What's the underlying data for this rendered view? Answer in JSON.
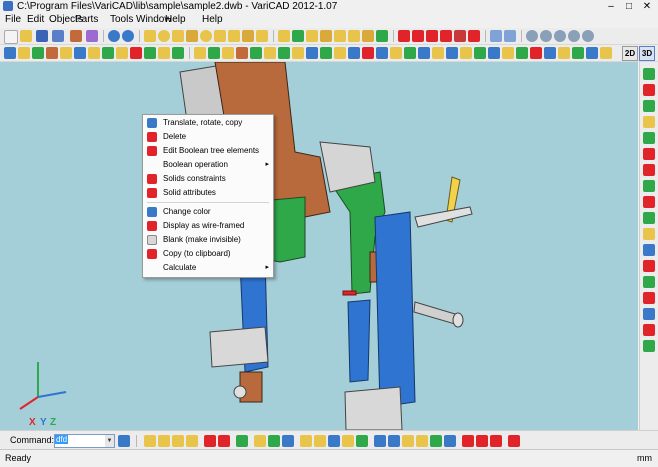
{
  "window": {
    "title": "C:\\Program Files\\VariCAD\\lib\\sample\\sample2.dwb - VariCAD 2012-1.07",
    "minimize": "–",
    "maximize": "□",
    "close": "✕"
  },
  "menu": [
    "File",
    "Edit",
    "Objects",
    "Parts",
    "Tools",
    "Window",
    "Help"
  ],
  "toolbar": {
    "view2d": "2D",
    "view3d": "3D"
  },
  "context_menu": {
    "items": [
      {
        "label": "Translate, rotate, copy",
        "icon": "translate-icon",
        "submenu": false
      },
      {
        "label": "Delete",
        "icon": "delete-icon",
        "submenu": false
      },
      {
        "label": "Edit Boolean tree elements",
        "icon": "boolean-tree-icon",
        "submenu": false
      },
      {
        "label": "Boolean operation",
        "icon": "",
        "submenu": true
      },
      {
        "label": "Solids constraints",
        "icon": "constraints-icon",
        "submenu": false
      },
      {
        "label": "Solid attributes",
        "icon": "attributes-icon",
        "submenu": false
      },
      {
        "label": "Change color",
        "icon": "color-icon",
        "submenu": false
      },
      {
        "label": "Display as wire-framed",
        "icon": "wireframe-icon",
        "submenu": false
      },
      {
        "label": "Blank (make invisible)",
        "icon": "blank-icon",
        "submenu": false
      },
      {
        "label": "Copy (to clipboard)",
        "icon": "copy-icon",
        "submenu": false
      },
      {
        "label": "Calculate",
        "icon": "",
        "submenu": true
      }
    ],
    "submenu_arrow": "▸"
  },
  "axes": {
    "x": "X",
    "y": "Y",
    "z": "Z"
  },
  "command": {
    "label": "Command:",
    "value": "dfd",
    "dropdown": "▼"
  },
  "status": {
    "left": "Ready",
    "units": "mm"
  },
  "colors": {
    "viewport_bg": "#a5cfd8",
    "part_brown": "#b86a3c",
    "part_green": "#2fa84a",
    "part_blue": "#2e74d0",
    "part_gray": "#c9c9c9",
    "part_yellow": "#f2d14b",
    "part_red": "#e0242a"
  }
}
